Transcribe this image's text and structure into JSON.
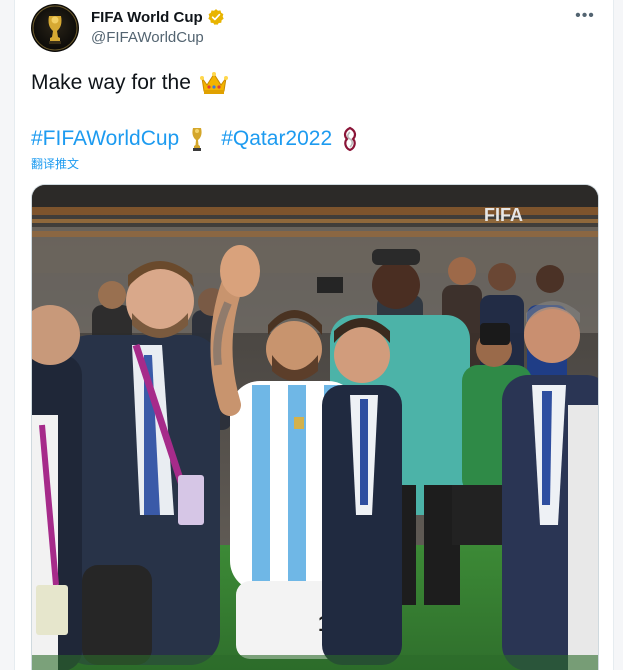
{
  "author": {
    "display_name": "FIFA World Cup",
    "handle": "@FIFAWorldCup",
    "verified": true,
    "avatar_icon": "trophy-icon"
  },
  "tweet": {
    "text": "Make way for the",
    "text_emoji": "crown-emoji",
    "hashtags": [
      {
        "label": "#FIFAWorldCup",
        "emoji": "trophy-emoji"
      },
      {
        "label": "#Qatar2022",
        "emoji": "qatar-emblem-emoji"
      }
    ],
    "translate_label": "翻译推文"
  },
  "media": {
    "banner_text": "FIFA",
    "jersey_number": "10"
  },
  "colors": {
    "link": "#1d9bf0",
    "secondary_text": "#536471",
    "verified": "#e8b400",
    "pitch": "#3f8a3a"
  }
}
